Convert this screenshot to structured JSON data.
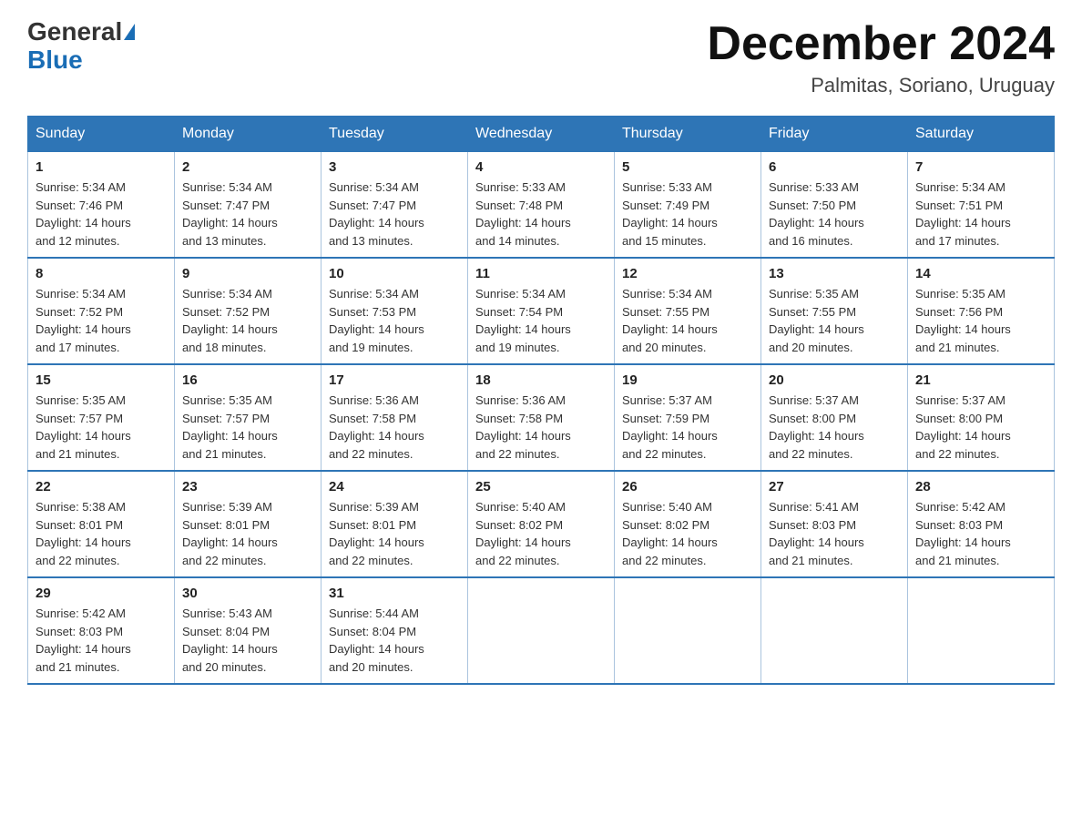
{
  "header": {
    "logo_general": "General",
    "logo_blue": "Blue",
    "month_title": "December 2024",
    "subtitle": "Palmitas, Soriano, Uruguay"
  },
  "weekdays": [
    "Sunday",
    "Monday",
    "Tuesday",
    "Wednesday",
    "Thursday",
    "Friday",
    "Saturday"
  ],
  "weeks": [
    [
      {
        "day": "1",
        "info": "Sunrise: 5:34 AM\nSunset: 7:46 PM\nDaylight: 14 hours\nand 12 minutes."
      },
      {
        "day": "2",
        "info": "Sunrise: 5:34 AM\nSunset: 7:47 PM\nDaylight: 14 hours\nand 13 minutes."
      },
      {
        "day": "3",
        "info": "Sunrise: 5:34 AM\nSunset: 7:47 PM\nDaylight: 14 hours\nand 13 minutes."
      },
      {
        "day": "4",
        "info": "Sunrise: 5:33 AM\nSunset: 7:48 PM\nDaylight: 14 hours\nand 14 minutes."
      },
      {
        "day": "5",
        "info": "Sunrise: 5:33 AM\nSunset: 7:49 PM\nDaylight: 14 hours\nand 15 minutes."
      },
      {
        "day": "6",
        "info": "Sunrise: 5:33 AM\nSunset: 7:50 PM\nDaylight: 14 hours\nand 16 minutes."
      },
      {
        "day": "7",
        "info": "Sunrise: 5:34 AM\nSunset: 7:51 PM\nDaylight: 14 hours\nand 17 minutes."
      }
    ],
    [
      {
        "day": "8",
        "info": "Sunrise: 5:34 AM\nSunset: 7:52 PM\nDaylight: 14 hours\nand 17 minutes."
      },
      {
        "day": "9",
        "info": "Sunrise: 5:34 AM\nSunset: 7:52 PM\nDaylight: 14 hours\nand 18 minutes."
      },
      {
        "day": "10",
        "info": "Sunrise: 5:34 AM\nSunset: 7:53 PM\nDaylight: 14 hours\nand 19 minutes."
      },
      {
        "day": "11",
        "info": "Sunrise: 5:34 AM\nSunset: 7:54 PM\nDaylight: 14 hours\nand 19 minutes."
      },
      {
        "day": "12",
        "info": "Sunrise: 5:34 AM\nSunset: 7:55 PM\nDaylight: 14 hours\nand 20 minutes."
      },
      {
        "day": "13",
        "info": "Sunrise: 5:35 AM\nSunset: 7:55 PM\nDaylight: 14 hours\nand 20 minutes."
      },
      {
        "day": "14",
        "info": "Sunrise: 5:35 AM\nSunset: 7:56 PM\nDaylight: 14 hours\nand 21 minutes."
      }
    ],
    [
      {
        "day": "15",
        "info": "Sunrise: 5:35 AM\nSunset: 7:57 PM\nDaylight: 14 hours\nand 21 minutes."
      },
      {
        "day": "16",
        "info": "Sunrise: 5:35 AM\nSunset: 7:57 PM\nDaylight: 14 hours\nand 21 minutes."
      },
      {
        "day": "17",
        "info": "Sunrise: 5:36 AM\nSunset: 7:58 PM\nDaylight: 14 hours\nand 22 minutes."
      },
      {
        "day": "18",
        "info": "Sunrise: 5:36 AM\nSunset: 7:58 PM\nDaylight: 14 hours\nand 22 minutes."
      },
      {
        "day": "19",
        "info": "Sunrise: 5:37 AM\nSunset: 7:59 PM\nDaylight: 14 hours\nand 22 minutes."
      },
      {
        "day": "20",
        "info": "Sunrise: 5:37 AM\nSunset: 8:00 PM\nDaylight: 14 hours\nand 22 minutes."
      },
      {
        "day": "21",
        "info": "Sunrise: 5:37 AM\nSunset: 8:00 PM\nDaylight: 14 hours\nand 22 minutes."
      }
    ],
    [
      {
        "day": "22",
        "info": "Sunrise: 5:38 AM\nSunset: 8:01 PM\nDaylight: 14 hours\nand 22 minutes."
      },
      {
        "day": "23",
        "info": "Sunrise: 5:39 AM\nSunset: 8:01 PM\nDaylight: 14 hours\nand 22 minutes."
      },
      {
        "day": "24",
        "info": "Sunrise: 5:39 AM\nSunset: 8:01 PM\nDaylight: 14 hours\nand 22 minutes."
      },
      {
        "day": "25",
        "info": "Sunrise: 5:40 AM\nSunset: 8:02 PM\nDaylight: 14 hours\nand 22 minutes."
      },
      {
        "day": "26",
        "info": "Sunrise: 5:40 AM\nSunset: 8:02 PM\nDaylight: 14 hours\nand 22 minutes."
      },
      {
        "day": "27",
        "info": "Sunrise: 5:41 AM\nSunset: 8:03 PM\nDaylight: 14 hours\nand 21 minutes."
      },
      {
        "day": "28",
        "info": "Sunrise: 5:42 AM\nSunset: 8:03 PM\nDaylight: 14 hours\nand 21 minutes."
      }
    ],
    [
      {
        "day": "29",
        "info": "Sunrise: 5:42 AM\nSunset: 8:03 PM\nDaylight: 14 hours\nand 21 minutes."
      },
      {
        "day": "30",
        "info": "Sunrise: 5:43 AM\nSunset: 8:04 PM\nDaylight: 14 hours\nand 20 minutes."
      },
      {
        "day": "31",
        "info": "Sunrise: 5:44 AM\nSunset: 8:04 PM\nDaylight: 14 hours\nand 20 minutes."
      },
      {
        "day": "",
        "info": ""
      },
      {
        "day": "",
        "info": ""
      },
      {
        "day": "",
        "info": ""
      },
      {
        "day": "",
        "info": ""
      }
    ]
  ]
}
